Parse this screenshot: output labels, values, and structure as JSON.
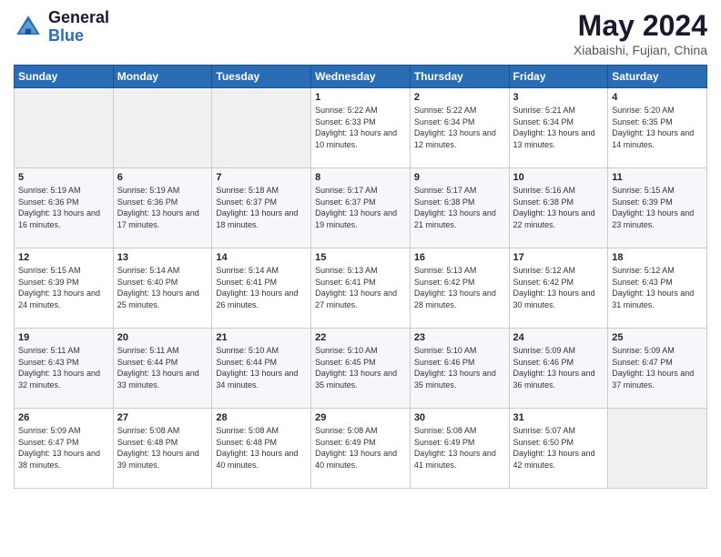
{
  "header": {
    "logo": {
      "general": "General",
      "blue": "Blue"
    },
    "title": "May 2024",
    "location": "Xiabaishi, Fujian, China"
  },
  "weekdays": [
    "Sunday",
    "Monday",
    "Tuesday",
    "Wednesday",
    "Thursday",
    "Friday",
    "Saturday"
  ],
  "weeks": [
    [
      {
        "day": "",
        "empty": true
      },
      {
        "day": "",
        "empty": true
      },
      {
        "day": "",
        "empty": true
      },
      {
        "day": "1",
        "sunrise": "5:22 AM",
        "sunset": "6:33 PM",
        "daylight": "13 hours and 10 minutes."
      },
      {
        "day": "2",
        "sunrise": "5:22 AM",
        "sunset": "6:34 PM",
        "daylight": "13 hours and 12 minutes."
      },
      {
        "day": "3",
        "sunrise": "5:21 AM",
        "sunset": "6:34 PM",
        "daylight": "13 hours and 13 minutes."
      },
      {
        "day": "4",
        "sunrise": "5:20 AM",
        "sunset": "6:35 PM",
        "daylight": "13 hours and 14 minutes."
      }
    ],
    [
      {
        "day": "5",
        "sunrise": "5:19 AM",
        "sunset": "6:36 PM",
        "daylight": "13 hours and 16 minutes."
      },
      {
        "day": "6",
        "sunrise": "5:19 AM",
        "sunset": "6:36 PM",
        "daylight": "13 hours and 17 minutes."
      },
      {
        "day": "7",
        "sunrise": "5:18 AM",
        "sunset": "6:37 PM",
        "daylight": "13 hours and 18 minutes."
      },
      {
        "day": "8",
        "sunrise": "5:17 AM",
        "sunset": "6:37 PM",
        "daylight": "13 hours and 19 minutes."
      },
      {
        "day": "9",
        "sunrise": "5:17 AM",
        "sunset": "6:38 PM",
        "daylight": "13 hours and 21 minutes."
      },
      {
        "day": "10",
        "sunrise": "5:16 AM",
        "sunset": "6:38 PM",
        "daylight": "13 hours and 22 minutes."
      },
      {
        "day": "11",
        "sunrise": "5:15 AM",
        "sunset": "6:39 PM",
        "daylight": "13 hours and 23 minutes."
      }
    ],
    [
      {
        "day": "12",
        "sunrise": "5:15 AM",
        "sunset": "6:39 PM",
        "daylight": "13 hours and 24 minutes."
      },
      {
        "day": "13",
        "sunrise": "5:14 AM",
        "sunset": "6:40 PM",
        "daylight": "13 hours and 25 minutes."
      },
      {
        "day": "14",
        "sunrise": "5:14 AM",
        "sunset": "6:41 PM",
        "daylight": "13 hours and 26 minutes."
      },
      {
        "day": "15",
        "sunrise": "5:13 AM",
        "sunset": "6:41 PM",
        "daylight": "13 hours and 27 minutes."
      },
      {
        "day": "16",
        "sunrise": "5:13 AM",
        "sunset": "6:42 PM",
        "daylight": "13 hours and 28 minutes."
      },
      {
        "day": "17",
        "sunrise": "5:12 AM",
        "sunset": "6:42 PM",
        "daylight": "13 hours and 30 minutes."
      },
      {
        "day": "18",
        "sunrise": "5:12 AM",
        "sunset": "6:43 PM",
        "daylight": "13 hours and 31 minutes."
      }
    ],
    [
      {
        "day": "19",
        "sunrise": "5:11 AM",
        "sunset": "6:43 PM",
        "daylight": "13 hours and 32 minutes."
      },
      {
        "day": "20",
        "sunrise": "5:11 AM",
        "sunset": "6:44 PM",
        "daylight": "13 hours and 33 minutes."
      },
      {
        "day": "21",
        "sunrise": "5:10 AM",
        "sunset": "6:44 PM",
        "daylight": "13 hours and 34 minutes."
      },
      {
        "day": "22",
        "sunrise": "5:10 AM",
        "sunset": "6:45 PM",
        "daylight": "13 hours and 35 minutes."
      },
      {
        "day": "23",
        "sunrise": "5:10 AM",
        "sunset": "6:46 PM",
        "daylight": "13 hours and 35 minutes."
      },
      {
        "day": "24",
        "sunrise": "5:09 AM",
        "sunset": "6:46 PM",
        "daylight": "13 hours and 36 minutes."
      },
      {
        "day": "25",
        "sunrise": "5:09 AM",
        "sunset": "6:47 PM",
        "daylight": "13 hours and 37 minutes."
      }
    ],
    [
      {
        "day": "26",
        "sunrise": "5:09 AM",
        "sunset": "6:47 PM",
        "daylight": "13 hours and 38 minutes."
      },
      {
        "day": "27",
        "sunrise": "5:08 AM",
        "sunset": "6:48 PM",
        "daylight": "13 hours and 39 minutes."
      },
      {
        "day": "28",
        "sunrise": "5:08 AM",
        "sunset": "6:48 PM",
        "daylight": "13 hours and 40 minutes."
      },
      {
        "day": "29",
        "sunrise": "5:08 AM",
        "sunset": "6:49 PM",
        "daylight": "13 hours and 40 minutes."
      },
      {
        "day": "30",
        "sunrise": "5:08 AM",
        "sunset": "6:49 PM",
        "daylight": "13 hours and 41 minutes."
      },
      {
        "day": "31",
        "sunrise": "5:07 AM",
        "sunset": "6:50 PM",
        "daylight": "13 hours and 42 minutes."
      },
      {
        "day": "",
        "empty": true
      }
    ]
  ],
  "labels": {
    "sunrise": "Sunrise:",
    "sunset": "Sunset:",
    "daylight": "Daylight:"
  }
}
